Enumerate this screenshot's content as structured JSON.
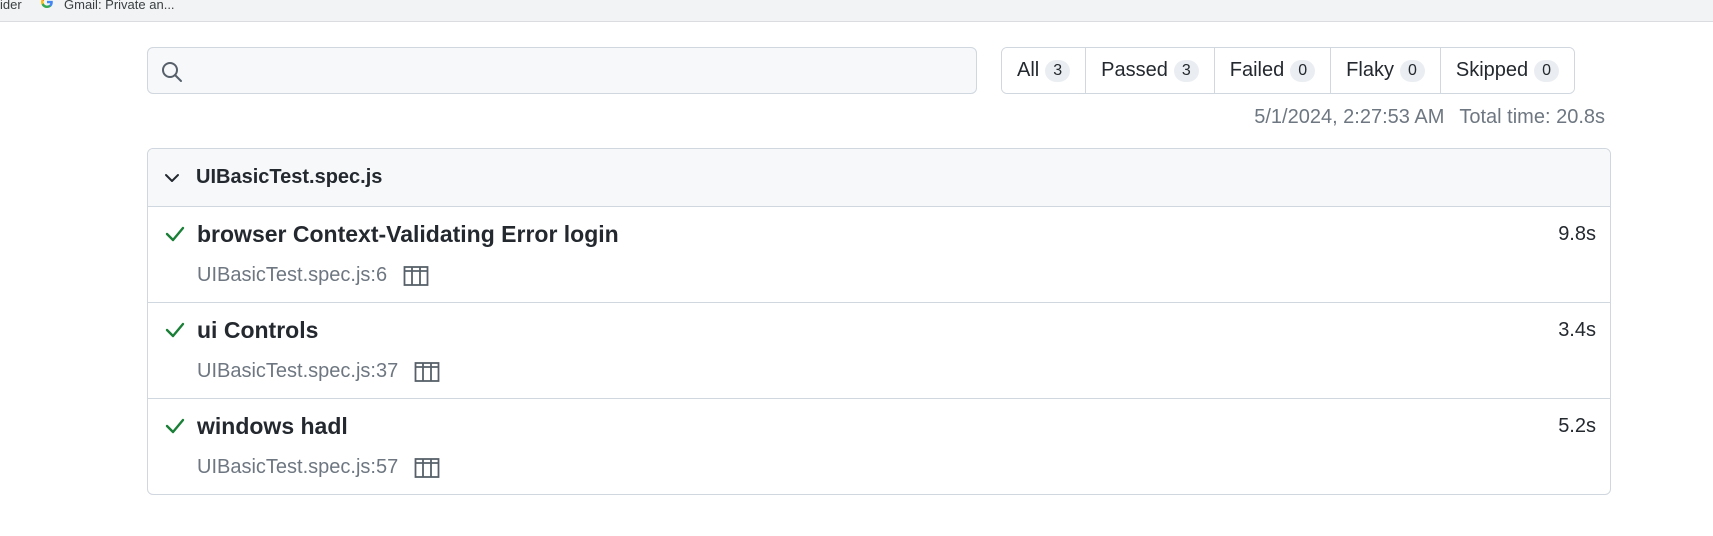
{
  "bookmarks": {
    "partial_label": "ider",
    "gmail_label": "Gmail: Private an..."
  },
  "search": {
    "value": "",
    "placeholder": ""
  },
  "filters": [
    {
      "label": "All",
      "count": "3"
    },
    {
      "label": "Passed",
      "count": "3"
    },
    {
      "label": "Failed",
      "count": "0"
    },
    {
      "label": "Flaky",
      "count": "0"
    },
    {
      "label": "Skipped",
      "count": "0"
    }
  ],
  "meta": {
    "date": "5/1/2024, 2:27:53 AM",
    "total_time": "Total time: 20.8s"
  },
  "file": {
    "name": "UIBasicTest.spec.js",
    "tests": [
      {
        "title": "browser Context-Validating Error login",
        "location": "UIBasicTest.spec.js:6",
        "duration": "9.8s",
        "status": "passed"
      },
      {
        "title": "ui Controls",
        "location": "UIBasicTest.spec.js:37",
        "duration": "3.4s",
        "status": "passed"
      },
      {
        "title": "windows hadl",
        "location": "UIBasicTest.spec.js:57",
        "duration": "5.2s",
        "status": "passed"
      }
    ]
  },
  "colors": {
    "pass": "#1a7f37",
    "border": "#d0d7de",
    "muted": "#6e7781"
  },
  "icons": [
    "google-icon",
    "search-icon",
    "chevron-down-icon",
    "check-icon",
    "trace-icon"
  ]
}
